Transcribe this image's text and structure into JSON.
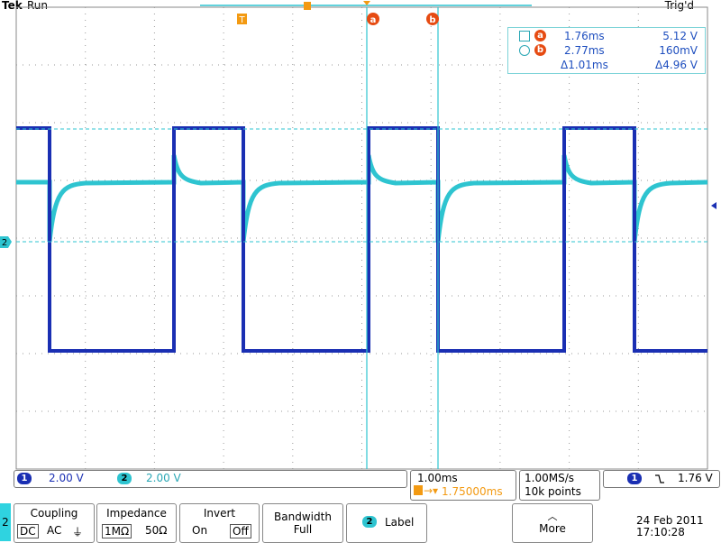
{
  "header": {
    "brand": "Tek",
    "run_state": "Run",
    "trigger_state": "Trig'd"
  },
  "markers": {
    "trigger_marker": "T",
    "cursor_a": "a",
    "cursor_b": "b",
    "channel2_ground": "2"
  },
  "cursor_readout": {
    "a": {
      "time": "1.76ms",
      "value": "5.12 V"
    },
    "b": {
      "time": "2.77ms",
      "value": "160mV"
    },
    "delta": {
      "time": "Δ1.01ms",
      "value": "Δ4.96 V"
    }
  },
  "channels": [
    {
      "number": "1",
      "scale": "2.00 V",
      "color": "#1a2fb3"
    },
    {
      "number": "2",
      "scale": "2.00 V",
      "color": "#2ec4d0"
    }
  ],
  "horizontal": {
    "scale": "1.00ms",
    "position": "1.75000ms"
  },
  "acquisition": {
    "sample_rate": "1.00MS/s",
    "record_length": "10k points"
  },
  "trigger": {
    "source": "1",
    "slope": "falling",
    "level": "1.76 V"
  },
  "menu": {
    "channel": "2",
    "coupling": {
      "title": "Coupling",
      "options": [
        "DC",
        "AC",
        "⏚"
      ],
      "selected": "DC"
    },
    "impedance": {
      "title": "Impedance",
      "options": [
        "1MΩ",
        "50Ω"
      ],
      "selected": "1MΩ"
    },
    "invert": {
      "title": "Invert",
      "options": [
        "On",
        "Off"
      ],
      "selected": "Off"
    },
    "bandwidth": {
      "title": "Bandwidth",
      "value": "Full"
    },
    "label": {
      "badge": "2",
      "text": "Label"
    },
    "more": {
      "text": "More"
    }
  },
  "datetime": {
    "date": "24 Feb  2011",
    "time": "17:10:28"
  },
  "colors": {
    "grid": "#9a9a9a",
    "ch1": "#1a2fb3",
    "ch2": "#2ec4d0",
    "cursor": "#2ec4d0",
    "marker_orange": "#f39a12",
    "badge_red": "#e64b12"
  }
}
